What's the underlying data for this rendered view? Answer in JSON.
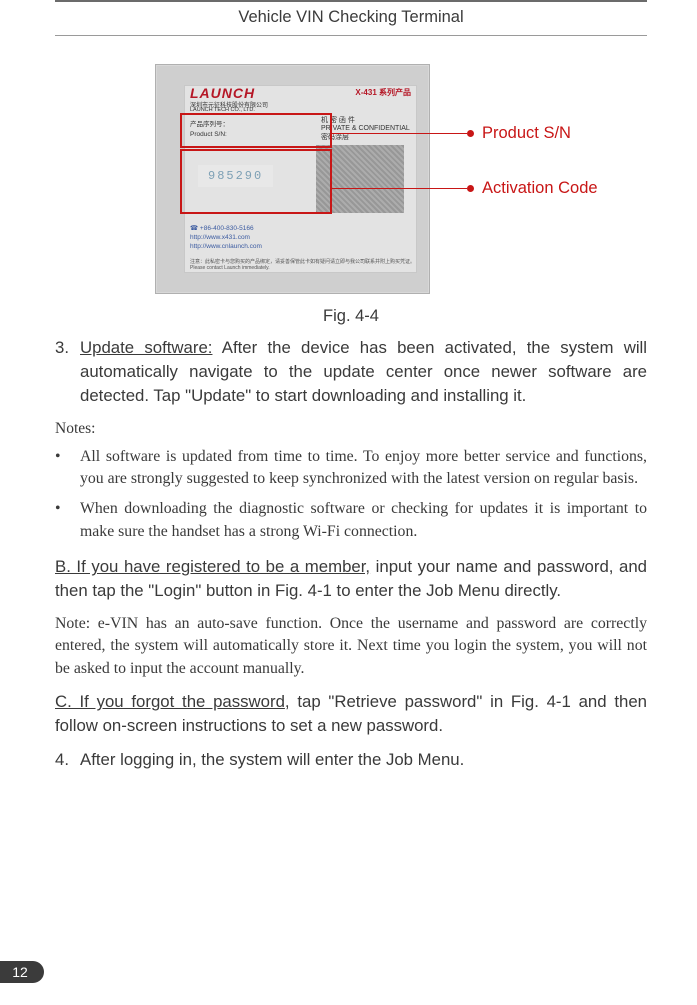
{
  "header": {
    "title": "Vehicle VIN Checking Terminal"
  },
  "figure": {
    "caption": "Fig. 4-4",
    "callout1": "Product S/N",
    "callout2": "Activation Code",
    "card": {
      "logo": "LAUNCH",
      "company_cn": "深圳市元征科技股份有限公司",
      "company_en": "LAUNCH TECH CO., LTD.",
      "xlogo": "X-431 系列产品",
      "label_cn": "产品序列号：",
      "label_en": "Product S/N:",
      "priv_cn": "机 密 函 件",
      "priv_en": "PRIVATE & CONFIDENTIAL",
      "priv_note": "密码涂层",
      "digits": "985290",
      "phone": "☎ +86-400-830-5166",
      "url1": "http://www.x431.com",
      "url2": "http://www.cnlaunch.com",
      "foot": "注意：此私密卡与您购买的产品绑定，请妥善保管此卡如有疑问请立即与我公司联系并附上购买凭证。Please contact Launch immediately."
    }
  },
  "item3": {
    "num": "3.",
    "lead": "Update software:",
    "text": " After the device has been activated, the system will automatically navigate to the update center once newer software are detected. Tap \"Update\" to start downloading and installing it."
  },
  "notes_title": "Notes:",
  "note1": "All software is updated from time to time. To enjoy more better service and functions,  you are strongly suggested to keep synchronized with the latest version on regular basis.",
  "note2": "When downloading the diagnostic software or checking for updates it is important to make sure the handset has a strong Wi-Fi connection.",
  "sectionB": {
    "lead": "B. If you have registered to be a member,",
    "text": " input your name and password, and then tap the \"Login\" button in Fig. 4-1 to enter the Job Menu directly."
  },
  "noteB": "Note: e-VIN has an auto-save function. Once the username and password are correctly entered, the system will automatically store it. Next time you login the system, you will not be asked to input the account manually.",
  "sectionC": {
    "lead": "C. If you forgot the password",
    "text": ", tap \"Retrieve password\" in Fig. 4-1 and then follow on-screen instructions to set a new password."
  },
  "item4": {
    "num": "4.",
    "text": "After logging in, the system will enter the Job Menu."
  },
  "page_number": "12"
}
